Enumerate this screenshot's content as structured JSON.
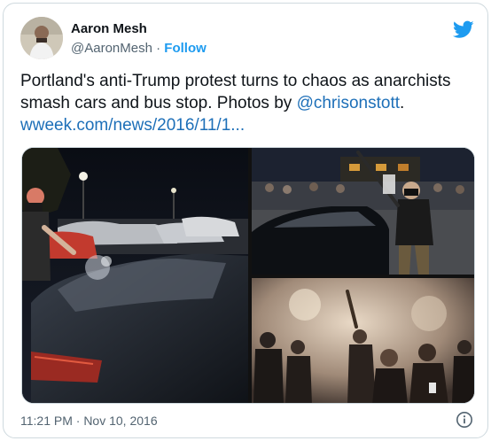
{
  "author": {
    "name": "Aaron Mesh",
    "handle": "@AaronMesh",
    "separator": "·",
    "follow_label": "Follow"
  },
  "tweet": {
    "text_plain": "Portland's anti-Trump protest turns to chaos as anarchists smash cars and bus stop. Photos by ",
    "mention": "@chrisonstott",
    "text_end": ".",
    "link": "wweek.com/news/2016/11/1..."
  },
  "photos": [
    {
      "subject": "protester smashing car window in parking lot at night"
    },
    {
      "subject": "masked protester with bat beside black car"
    },
    {
      "subject": "crowd in smoke on street with person holding bat"
    }
  ],
  "footer": {
    "timestamp": "11:21 PM · Nov 10, 2016"
  },
  "colors": {
    "accent": "#1d9bf0",
    "link": "#1d6fb8",
    "muted": "#536471",
    "border": "#cfd9de"
  },
  "icons": {
    "brand": "twitter-bird-icon",
    "info": "info-icon"
  }
}
